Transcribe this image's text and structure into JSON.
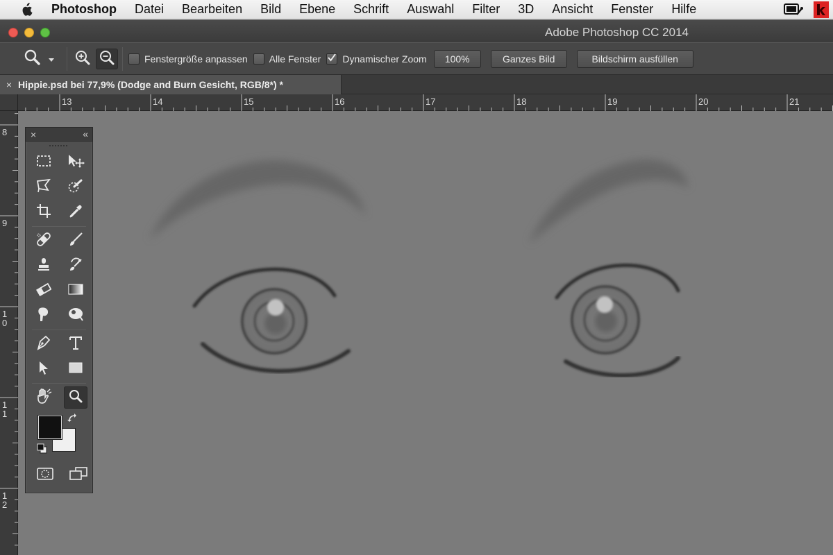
{
  "menubar": {
    "app": "Photoshop",
    "items": [
      "Datei",
      "Bearbeiten",
      "Bild",
      "Ebene",
      "Schrift",
      "Auswahl",
      "Filter",
      "3D",
      "Ansicht",
      "Fenster",
      "Hilfe"
    ]
  },
  "window": {
    "title": "Adobe Photoshop CC 2014"
  },
  "options": {
    "resize_windows_label": "Fenstergröße anpassen",
    "resize_windows_checked": false,
    "all_windows_label": "Alle Fenster",
    "all_windows_checked": false,
    "scrubby_zoom_label": "Dynamischer Zoom",
    "scrubby_zoom_checked": true,
    "zoom_100_label": "100%",
    "fit_screen_label": "Ganzes Bild",
    "fill_screen_label": "Bildschirm ausfüllen"
  },
  "document": {
    "tab_label": "Hippie.psd bei 77,9% (Dodge and Burn Gesicht, RGB/8*) *",
    "close_glyph": "×"
  },
  "rulers": {
    "top_labels": [
      "13",
      "14",
      "15",
      "16",
      "17",
      "18",
      "19",
      "20",
      "21"
    ],
    "left_labels": [
      "8",
      "9",
      "10",
      "11",
      "12"
    ]
  },
  "tools": {
    "panel_close": "×",
    "panel_collapse": "«",
    "active": "zoom-tool"
  },
  "colors": {
    "foreground": "#111111",
    "background": "#f0f0f0",
    "accent_close": "#ee5b54",
    "accent_minimize": "#f4bb3b",
    "accent_zoom": "#5fc145"
  }
}
